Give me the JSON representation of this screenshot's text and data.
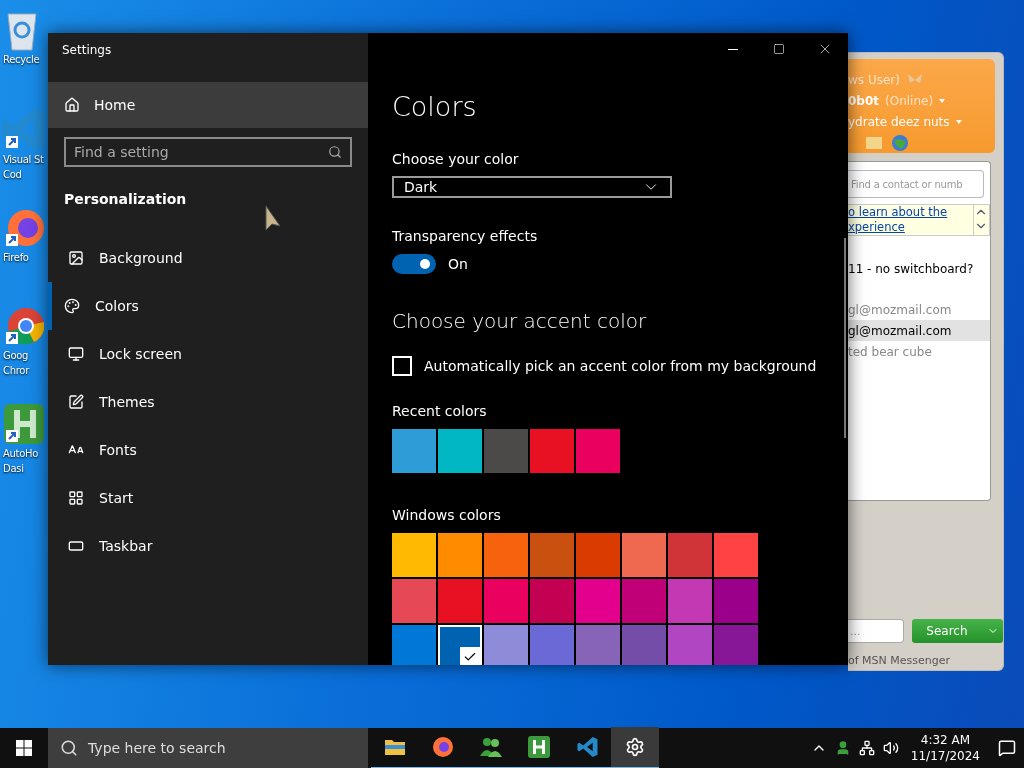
{
  "desktop": {
    "icons": [
      {
        "lines": [
          "Recycle"
        ]
      },
      {
        "lines": [
          "Visual St",
          "Cod"
        ]
      },
      {
        "lines": [
          "Firefo"
        ]
      },
      {
        "lines": [
          "Goog",
          "Chror"
        ]
      },
      {
        "lines": [
          "AutoHo",
          "Dasi"
        ]
      }
    ]
  },
  "settings": {
    "title": "Settings",
    "home": {
      "label": "Home",
      "hovered": true
    },
    "search": {
      "placeholder": "Find a setting"
    },
    "section": "Personalization",
    "nav": [
      {
        "label": "Background",
        "selected": false
      },
      {
        "label": "Colors",
        "selected": true
      },
      {
        "label": "Lock screen",
        "selected": false
      },
      {
        "label": "Themes",
        "selected": false
      },
      {
        "label": "Fonts",
        "selected": false
      },
      {
        "label": "Start",
        "selected": false
      },
      {
        "label": "Taskbar",
        "selected": false
      }
    ],
    "page_title": "Colors",
    "choose_color": {
      "label": "Choose your color",
      "value": "Dark"
    },
    "transparency": {
      "label": "Transparency effects",
      "on": true,
      "state_label": "On"
    },
    "accent_heading": "Choose your accent color",
    "auto_accent": {
      "label": "Automatically pick an accent color from my background",
      "checked": false
    },
    "recent_label": "Recent colors",
    "recent_colors": [
      {
        "color": "#2d9cd7"
      },
      {
        "color": "#00b7c3"
      },
      {
        "color": "#4c4a48"
      },
      {
        "color": "#e81123"
      },
      {
        "color": "#ea005e"
      }
    ],
    "windows_label": "Windows colors",
    "windows_colors": [
      {
        "color": "#ffb900",
        "selected": false
      },
      {
        "color": "#ff8c00",
        "selected": false
      },
      {
        "color": "#f7630c",
        "selected": false
      },
      {
        "color": "#ca5010",
        "selected": false
      },
      {
        "color": "#da3b01",
        "selected": false
      },
      {
        "color": "#ef6950",
        "selected": false
      },
      {
        "color": "#d13438",
        "selected": false
      },
      {
        "color": "#ff4343",
        "selected": false
      },
      {
        "color": "#e74856",
        "selected": false
      },
      {
        "color": "#e81123",
        "selected": false
      },
      {
        "color": "#ea005e",
        "selected": false
      },
      {
        "color": "#c30052",
        "selected": false
      },
      {
        "color": "#e3008c",
        "selected": false
      },
      {
        "color": "#bf0077",
        "selected": false
      },
      {
        "color": "#c239b3",
        "selected": false
      },
      {
        "color": "#9a0089",
        "selected": false
      },
      {
        "color": "#0078d7",
        "selected": false
      },
      {
        "color": "#0063b1",
        "selected": true
      },
      {
        "color": "#8e8cd8",
        "selected": false
      },
      {
        "color": "#6b69d6",
        "selected": false
      },
      {
        "color": "#8764b8",
        "selected": false
      },
      {
        "color": "#744da9",
        "selected": false
      },
      {
        "color": "#b146c2",
        "selected": false
      },
      {
        "color": "#881798",
        "selected": false
      }
    ]
  },
  "messenger": {
    "account": "ws User)",
    "name": "0b0t",
    "status": "(Online)",
    "message": "ydrate deez nuts",
    "search": {
      "placeholder": "Find a contact or numb"
    },
    "info_link": [
      "o learn about the",
      "xperience"
    ],
    "contacts": [
      {
        "label": "11 - no switchboard?",
        "selected": false,
        "offline": false
      },
      {
        "label": "gl@mozmail.com",
        "selected": false,
        "offline": true
      },
      {
        "label": "gl@mozmail.com",
        "selected": true,
        "offline": false
      },
      {
        "label": "ted bear cube",
        "selected": false,
        "offline": true
      }
    ],
    "web_search": {
      "placeholder": "..."
    },
    "search_button": "Search",
    "footer": "of MSN Messenger"
  },
  "taskbar": {
    "search": {
      "placeholder": "Type here to search"
    },
    "apps": [
      {
        "selected": false
      },
      {
        "selected": false
      },
      {
        "selected": false
      },
      {
        "selected": false
      },
      {
        "selected": false
      },
      {
        "selected": true
      }
    ],
    "time": "4:32 AM",
    "date": "11/17/2024"
  }
}
